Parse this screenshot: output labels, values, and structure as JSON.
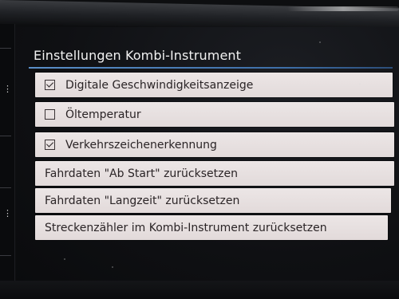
{
  "screen": {
    "title": "Einstellungen Kombi-Instrument",
    "accent_color": "#4a82c0"
  },
  "menu": {
    "items": [
      {
        "label": "Digitale Geschwindigkeitsanzeige",
        "type": "checkbox",
        "checked": true
      },
      {
        "label": "Öltemperatur",
        "type": "checkbox",
        "checked": false
      },
      {
        "label": "Verkehrszeichenerkennung",
        "type": "checkbox",
        "checked": true
      },
      {
        "label": "Fahrdaten \"Ab Start\" zurücksetzen",
        "type": "action"
      },
      {
        "label": "Fahrdaten \"Langzeit\" zurücksetzen",
        "type": "action"
      },
      {
        "label": "Streckenzähler im Kombi-Instrument zurücksetzen",
        "type": "action"
      }
    ]
  }
}
